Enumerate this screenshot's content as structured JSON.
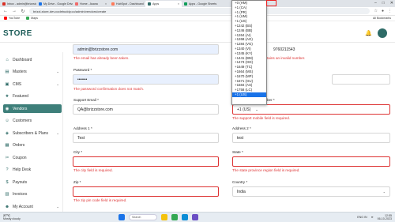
{
  "browser": {
    "tabs": [
      {
        "label": "Inbox - admin@brizzstore...",
        "color": "#d93025"
      },
      {
        "label": "My Drive - Google Drive",
        "color": "#1a73e8"
      },
      {
        "label": "Home - Asana",
        "color": "#f06a6a"
      },
      {
        "label": "HubSpot - Dashboard",
        "color": "#ff7a59"
      },
      {
        "label": "Apps",
        "color": "#2e6b67"
      },
      {
        "label": "Apps - Google Sheets",
        "color": "#0f9d58"
      }
    ],
    "url": "brizzl-store-dev.codebuddy.co/admin/vendors/create",
    "bookmarks": [
      {
        "label": "YouTube",
        "color": "#ff0000"
      },
      {
        "label": "Maps",
        "color": "#34a853"
      }
    ],
    "bookmarks_right": "All Bookmarks"
  },
  "app": {
    "logo": "STORE"
  },
  "sidebar": {
    "items": [
      {
        "label": "Dashboard",
        "icon": "⌂"
      },
      {
        "label": "Masters",
        "icon": "▤",
        "chevron": "⌄"
      },
      {
        "label": "CMS",
        "icon": "▣",
        "chevron": "⌄"
      },
      {
        "label": "Featured",
        "icon": "★"
      },
      {
        "label": "Vendors",
        "icon": "◉"
      },
      {
        "label": "Customers",
        "icon": "☺"
      },
      {
        "label": "Subscribers & Plans",
        "icon": "◈",
        "chevron": "⌄"
      },
      {
        "label": "Orders",
        "icon": "▦"
      },
      {
        "label": "Coupon",
        "icon": "✂"
      },
      {
        "label": "Help Desk",
        "icon": "?"
      },
      {
        "label": "Payouts",
        "icon": "$"
      },
      {
        "label": "Invoices",
        "icon": "▧"
      },
      {
        "label": "My Account",
        "icon": "☻",
        "chevron": "⌄"
      }
    ]
  },
  "form": {
    "email_value": "admin@brizzstore.com",
    "email_error": "The email has already been taken.",
    "phone_error_tail": "tains an invalid number.",
    "phone_value": "9760211543",
    "password_label": "Password *",
    "password_value": "•••••••",
    "password_error": "The password confirmation does not match.",
    "support_email_label": "Support Email *",
    "support_email_value": "QA@brizzstore.com",
    "support_mobile_label": "ber *",
    "support_mobile_code": "+1 (US)",
    "support_mobile_error": "The support mobile field is required.",
    "address1_label": "Address 1 *",
    "address1_value": "Test",
    "address2_label": "Address 2 *",
    "address2_value": "test",
    "city_label": "City *",
    "city_error": "The city field is required.",
    "state_label": "State *",
    "state_error": "The state province region field is required.",
    "zip_label": "Zip *",
    "zip_error": "The zip pin code field is required.",
    "country_label": "Country *",
    "country_value": "India"
  },
  "country_code_dropdown": {
    "options": [
      "+0 (HM)",
      "+1 (CA)",
      "+1 (PR)",
      "+1 (UM)",
      "+1 (US)",
      "+1242 (BS)",
      "+1246 (BB)",
      "+1264 (AI)",
      "+1268 (AG)",
      "+1284 (VG)",
      "+1340 (VI)",
      "+1345 (KY)",
      "+1441 (BM)",
      "+1473 (GD)",
      "+1649 (TC)",
      "+1664 (MS)",
      "+1670 (MP)",
      "+1671 (GU)",
      "+1684 (AS)",
      "+1758 (LC)",
      "+1 (US)"
    ],
    "selected_index": 20
  },
  "taskbar": {
    "temp": "27°C",
    "weather": "Mostly cloudy",
    "search": "Search",
    "time": "12:55",
    "date": "06-10-2023",
    "lang": "ENG IN"
  }
}
